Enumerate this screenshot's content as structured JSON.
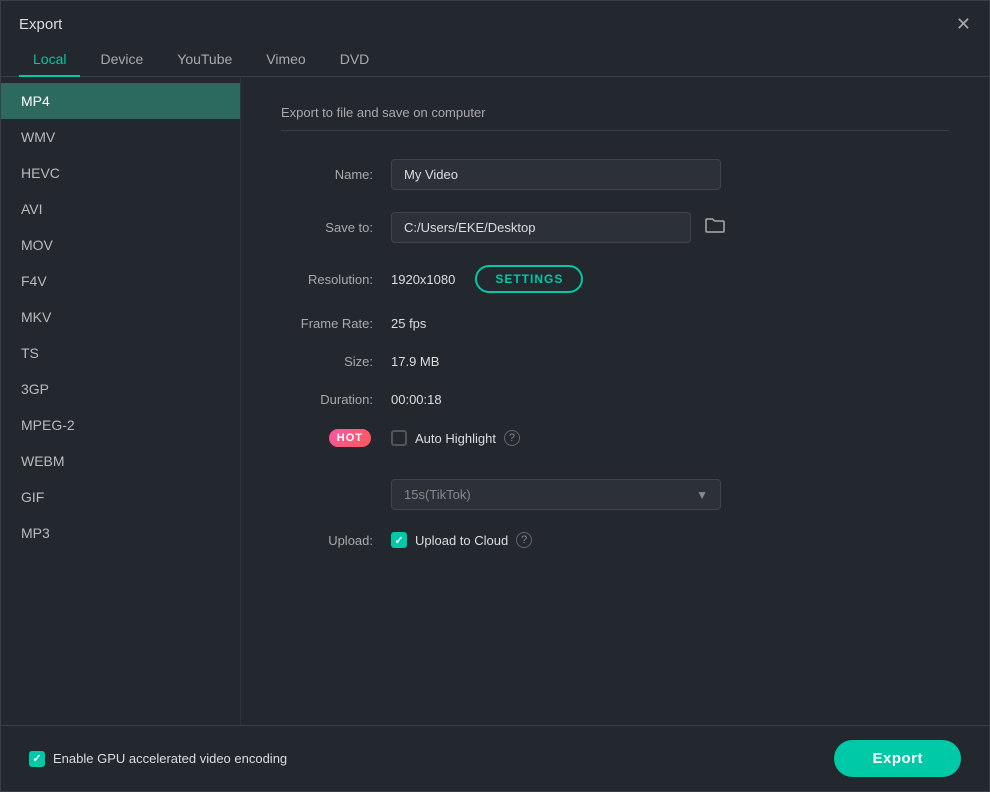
{
  "titleBar": {
    "title": "Export",
    "closeLabel": "✕"
  },
  "tabs": [
    {
      "id": "local",
      "label": "Local",
      "active": true
    },
    {
      "id": "device",
      "label": "Device",
      "active": false
    },
    {
      "id": "youtube",
      "label": "YouTube",
      "active": false
    },
    {
      "id": "vimeo",
      "label": "Vimeo",
      "active": false
    },
    {
      "id": "dvd",
      "label": "DVD",
      "active": false
    }
  ],
  "sidebar": {
    "items": [
      {
        "id": "mp4",
        "label": "MP4",
        "active": true
      },
      {
        "id": "wmv",
        "label": "WMV",
        "active": false
      },
      {
        "id": "hevc",
        "label": "HEVC",
        "active": false
      },
      {
        "id": "avi",
        "label": "AVI",
        "active": false
      },
      {
        "id": "mov",
        "label": "MOV",
        "active": false
      },
      {
        "id": "f4v",
        "label": "F4V",
        "active": false
      },
      {
        "id": "mkv",
        "label": "MKV",
        "active": false
      },
      {
        "id": "ts",
        "label": "TS",
        "active": false
      },
      {
        "id": "3gp",
        "label": "3GP",
        "active": false
      },
      {
        "id": "mpeg2",
        "label": "MPEG-2",
        "active": false
      },
      {
        "id": "webm",
        "label": "WEBM",
        "active": false
      },
      {
        "id": "gif",
        "label": "GIF",
        "active": false
      },
      {
        "id": "mp3",
        "label": "MP3",
        "active": false
      }
    ]
  },
  "content": {
    "description": "Export to file and save on computer",
    "nameLabel": "Name:",
    "nameValue": "My Video",
    "saveToLabel": "Save to:",
    "saveToPath": "C:/Users/EKE/Desktop",
    "resolutionLabel": "Resolution:",
    "resolutionValue": "1920x1080",
    "settingsLabel": "SETTINGS",
    "frameRateLabel": "Frame Rate:",
    "frameRateValue": "25 fps",
    "sizeLabel": "Size:",
    "sizeValue": "17.9 MB",
    "durationLabel": "Duration:",
    "durationValue": "00:00:18",
    "hotBadge": "HOT",
    "autoHighlightLabel": "Auto Highlight",
    "autoHighlightChecked": false,
    "dropdownValue": "15s(TikTok)",
    "uploadLabel": "Upload:",
    "uploadToCloudLabel": "Upload to Cloud",
    "uploadChecked": true,
    "gpuLabel": "Enable GPU accelerated video encoding",
    "gpuChecked": true,
    "exportLabel": "Export",
    "helpIconLabel": "?"
  }
}
